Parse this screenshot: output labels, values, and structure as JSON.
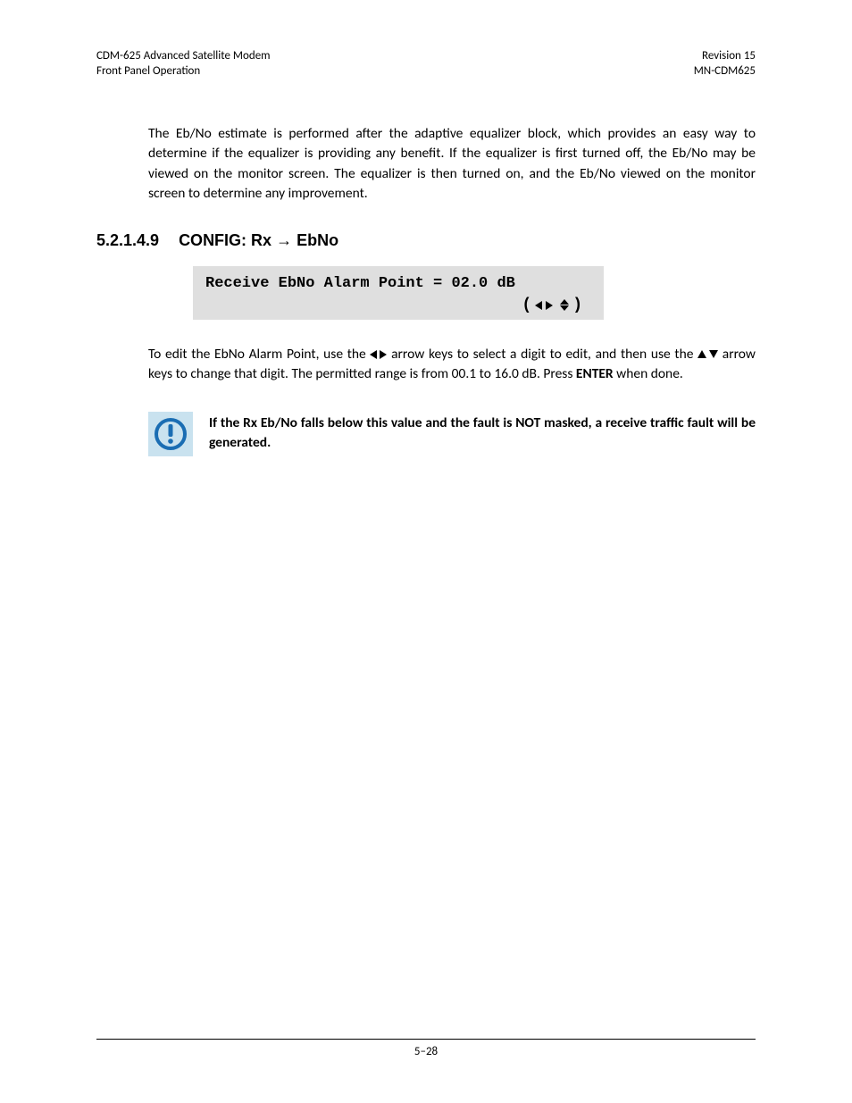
{
  "header": {
    "left_line1": "CDM-625 Advanced Satellite Modem",
    "left_line2": "Front Panel Operation",
    "right_line1": "Revision 15",
    "right_line2": "MN-CDM625"
  },
  "paragraph1": "The Eb/No estimate is performed after the adaptive equalizer block, which provides an easy way to determine if the equalizer is providing any benefit. If the equalizer is first turned off, the Eb/No may be viewed on the monitor screen. The equalizer is then turned on, and the Eb/No viewed on the monitor screen to determine any improvement.",
  "section": {
    "number": "5.2.1.4.9",
    "title_prefix": "CONFIG: Rx ",
    "title_arrow": "→",
    "title_suffix": " EbNo"
  },
  "lcd": {
    "line1": "Receive EbNo Alarm Point = 02.0 dB"
  },
  "paragraph2": {
    "part1": "To edit the EbNo Alarm Point, use the ",
    "part2": " arrow keys to select a digit to edit, and then use the ",
    "part3": " arrow keys to change that digit. The permitted range is from 00.1 to 16.0 dB.  Press ",
    "enter": "ENTER",
    "part4": " when done."
  },
  "note": "If the Rx Eb/No falls below this value and the fault is NOT masked, a receive traffic fault will be generated.",
  "footer": {
    "page": "5–28"
  }
}
